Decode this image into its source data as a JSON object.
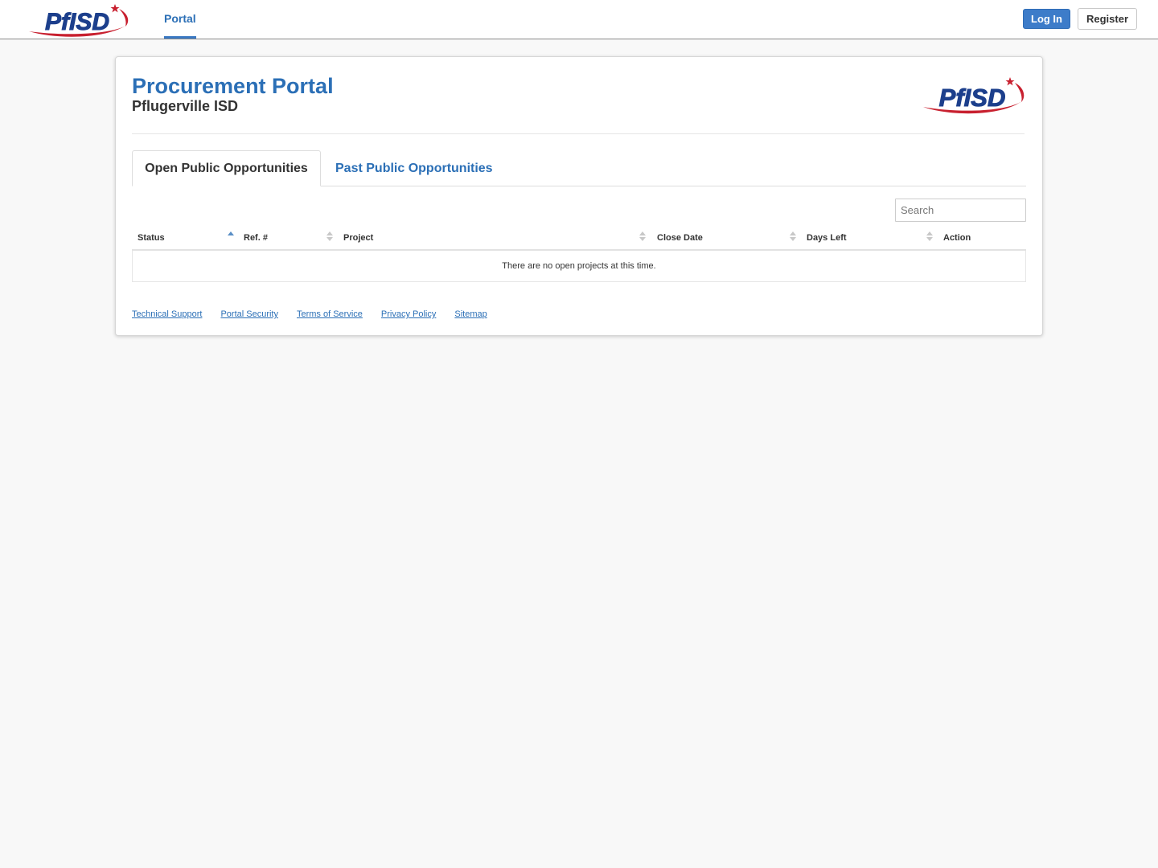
{
  "brand": {
    "logo_text": "PfISD",
    "primary_color": "#2b6fb6",
    "logo_red": "#c8202f",
    "logo_blue": "#1c3f8c"
  },
  "navbar": {
    "tab_label": "Portal",
    "login_label": "Log In",
    "register_label": "Register"
  },
  "header": {
    "title": "Procurement Portal",
    "subtitle": "Pflugerville ISD"
  },
  "tabs": [
    {
      "label": "Open Public Opportunities",
      "active": true
    },
    {
      "label": "Past Public Opportunities",
      "active": false
    }
  ],
  "search": {
    "placeholder": "Search",
    "value": ""
  },
  "table": {
    "columns": [
      {
        "label": "Status",
        "sort": "ascending"
      },
      {
        "label": "Ref. #",
        "sort": "none"
      },
      {
        "label": "Project",
        "sort": "none"
      },
      {
        "label": "Close Date",
        "sort": "none"
      },
      {
        "label": "Days Left",
        "sort": "none"
      },
      {
        "label": "Action",
        "sort": "none"
      }
    ],
    "empty_message": "There are no open projects at this time."
  },
  "footer": {
    "links": [
      "Technical Support",
      "Portal Security",
      "Terms of Service",
      "Privacy Policy",
      "Sitemap"
    ]
  }
}
